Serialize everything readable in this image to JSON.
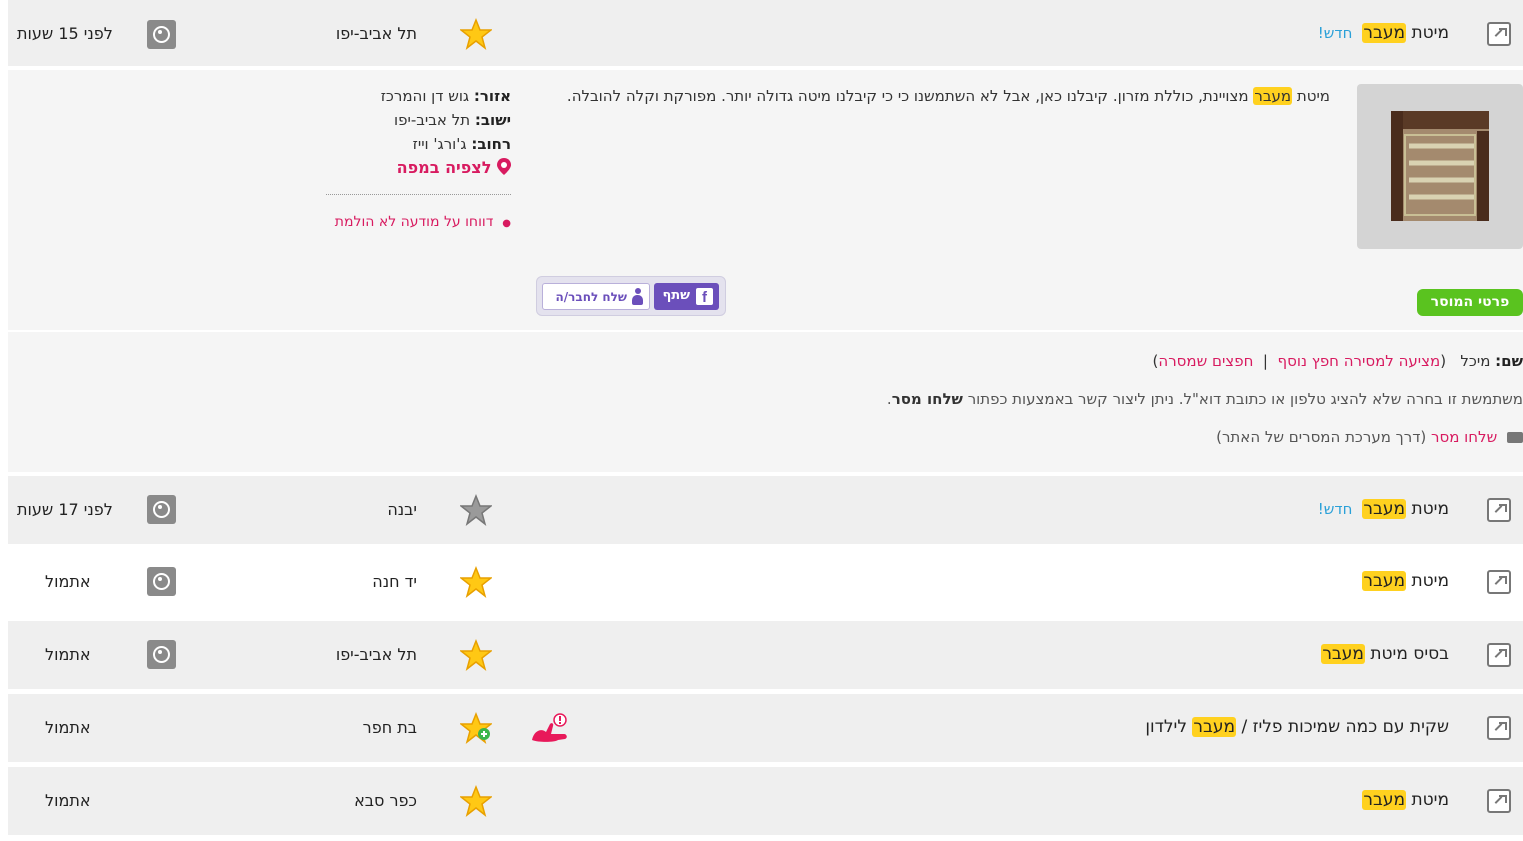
{
  "hl_word": "מעבר",
  "new_label": "חדש!",
  "items": [
    {
      "pre": "מיטת ",
      "post": "",
      "city": "תל אביב-יפו",
      "time": "לפני 15 שעות",
      "is_new": true,
      "star": "gold"
    },
    {
      "pre": "מיטת ",
      "post": "",
      "city": "יבנה",
      "time": "לפני 17 שעות",
      "is_new": true,
      "star": "gray"
    },
    {
      "pre": "מיטת ",
      "post": "",
      "city": "יד חנה",
      "time": "אתמול",
      "is_new": false,
      "star": "gold"
    },
    {
      "pre": "בסיס מיטת ",
      "post": "",
      "city": "תל אביב-יפו",
      "time": "אתמול",
      "is_new": false,
      "star": "gold"
    },
    {
      "pre": "שקית עם כמה שמיכות פליז / ",
      "post": " לילדון",
      "city": "בת חפר",
      "time": "אתמול",
      "is_new": false,
      "star": "gold-plus"
    },
    {
      "pre": "מיטת ",
      "post": "",
      "city": "כפר סבא",
      "time": "אתמול",
      "is_new": false,
      "star": "gold"
    }
  ],
  "detail": {
    "desc_pre": "מיטת ",
    "desc_post": " מצויינת, כוללת מזרון. קיבלנו כאן, אבל לא השתמשנו כי כי קיבלנו מיטה גדולה יותר. מפורקת וקלה להובלה.",
    "area_label": "אזור:",
    "area_value": "גוש דן והמרכז",
    "settlement_label": "ישוב:",
    "settlement_value": "תל אביב-יפו",
    "street_label": "רחוב:",
    "street_value": "ג'ורג' וייז",
    "map_link": "לצפיה במפה",
    "report_link": "דווחו על מודעה לא הולמת",
    "share_label": "שתף",
    "send_friend_label": "שלח לחבר/ה",
    "seller_details_label": "פרטי המוסר"
  },
  "seller": {
    "name_label": "שם:",
    "name_value": "מיכל",
    "more_link": "מציעה למסירה חפץ נוסף",
    "given_link": "חפצים שמסרה",
    "sep": "|",
    "paren_open": "(",
    "paren_close": ")",
    "notice_text": "משתמשת זו בחרה שלא להציג טלפון או כתובת דוא\"ל. ניתן ליצור קשר באמצעות כפתור ",
    "notice_bold": "שלחו מסר",
    "notice_end": ".",
    "send_msg_link": "שלחו מסר",
    "send_msg_note": "(דרך מערכת המסרים של האתר)"
  },
  "colors": {
    "highlight": "#ffd11f",
    "new": "#2aa0d8",
    "pink": "#d81b60",
    "green": "#5ac31f",
    "purple": "#6b4fbb"
  }
}
